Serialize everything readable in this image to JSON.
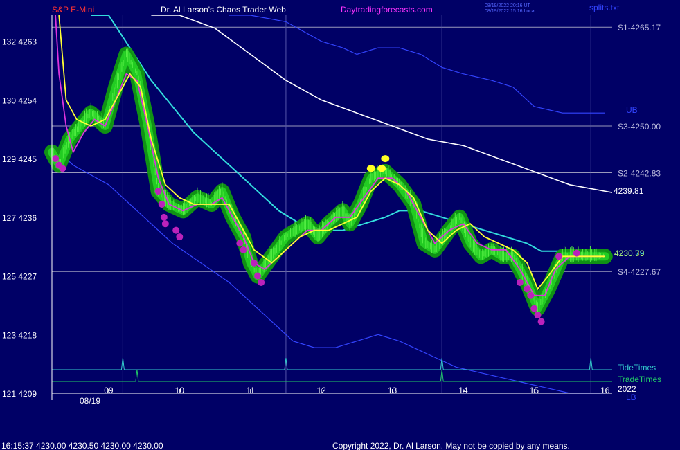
{
  "header": {
    "symbol": "S&P E-Mini",
    "site_title": "Dr. Al Larson's Chaos Trader Web",
    "site_url": "Daytradingforecasts.com",
    "utc_time": "08/19/2022 20:16 UT",
    "local_time": "08/19/2022 15:16 Local",
    "file": "splits.txt"
  },
  "footer": {
    "quote": "16:15:37  4230.00 4230.50 4230.00 4230.00",
    "copyright": "Copyright 2022, Dr. Al Larson. May not be copied by any means."
  },
  "colors": {
    "background": "#000066",
    "price": "#22cc22",
    "glow": "#119911",
    "yellow_avg": "#ffff33",
    "magenta_avg": "#dd33dd",
    "cyan_avg": "#33dddd",
    "white_avg": "#ffffff",
    "band": "#3344ff",
    "title_red": "#ff3333",
    "title_magenta": "#ff33ff",
    "tide": "#33cccc",
    "trade": "#22cc66"
  },
  "chart_data": {
    "type": "line",
    "y_axis": {
      "ticks": [
        {
          "price": 4263,
          "alt": "132",
          "label": "132  4263"
        },
        {
          "price": 4254,
          "alt": "130",
          "label": "130  4254"
        },
        {
          "price": 4245,
          "alt": "129",
          "label": "129  4245"
        },
        {
          "price": 4236,
          "alt": "127",
          "label": "127  4236"
        },
        {
          "price": 4227,
          "alt": "125",
          "label": "125  4227"
        },
        {
          "price": 4218,
          "alt": "123",
          "label": "123  4218"
        },
        {
          "price": 4209,
          "alt": "121",
          "label": "121  4209"
        }
      ],
      "range": [
        4209,
        4267
      ]
    },
    "x_axis": {
      "hour_ticks": [
        {
          "hour": 9,
          "label": "09"
        },
        {
          "hour": 10,
          "label": "10"
        },
        {
          "hour": 11,
          "label": "11"
        },
        {
          "hour": 12,
          "label": "12"
        },
        {
          "hour": 13,
          "label": "13"
        },
        {
          "hour": 14,
          "label": "14"
        },
        {
          "hour": 15,
          "label": "15"
        },
        {
          "hour": 16,
          "label": "16"
        }
      ],
      "date_label": "08/19",
      "year_label": "2022",
      "range": [
        8.2,
        16.1
      ]
    },
    "levels": [
      {
        "label": "S1-4265.17",
        "price": 4265.17
      },
      {
        "label": "S3-4250.00",
        "price": 4250.0
      },
      {
        "label": "S2-4242.83",
        "price": 4242.83
      },
      {
        "label": "S4-4227.67",
        "price": 4227.67
      }
    ],
    "right_labels": {
      "white_end": "4239.81",
      "white_end_price": 4239.81,
      "cyan_end": "4230.79",
      "yellow_end": "4230.33",
      "band_upper": "UB",
      "band_lower": "LB"
    },
    "vertical_lines_hours": [
      9.2,
      11.5,
      13.7,
      15.8
    ],
    "tide_times": {
      "label": "TideTimes",
      "spike_hours": [
        9.2,
        11.5,
        13.7,
        15.8
      ]
    },
    "trade_times": {
      "label": "TradeTimes",
      "spike_hours": [
        9.4,
        13.7
      ]
    },
    "series": [
      {
        "key": "price",
        "points": [
          [
            8.2,
            4246
          ],
          [
            8.3,
            4244
          ],
          [
            8.45,
            4248
          ],
          [
            8.6,
            4250
          ],
          [
            8.75,
            4252
          ],
          [
            8.95,
            4250
          ],
          [
            9.1,
            4256
          ],
          [
            9.25,
            4261
          ],
          [
            9.4,
            4258
          ],
          [
            9.55,
            4250
          ],
          [
            9.7,
            4240
          ],
          [
            9.85,
            4238
          ],
          [
            10.05,
            4237
          ],
          [
            10.25,
            4239
          ],
          [
            10.45,
            4238
          ],
          [
            10.6,
            4240
          ],
          [
            10.75,
            4236
          ],
          [
            10.9,
            4233
          ],
          [
            11.0,
            4229
          ],
          [
            11.1,
            4227
          ],
          [
            11.3,
            4230
          ],
          [
            11.5,
            4233
          ],
          [
            11.65,
            4234
          ],
          [
            11.8,
            4235
          ],
          [
            11.95,
            4233
          ],
          [
            12.1,
            4235
          ],
          [
            12.3,
            4237
          ],
          [
            12.4,
            4235
          ],
          [
            12.55,
            4238
          ],
          [
            12.7,
            4242
          ],
          [
            12.9,
            4243
          ],
          [
            13.1,
            4241
          ],
          [
            13.3,
            4238
          ],
          [
            13.45,
            4232
          ],
          [
            13.6,
            4231
          ],
          [
            13.8,
            4234
          ],
          [
            13.95,
            4236
          ],
          [
            14.1,
            4232
          ],
          [
            14.25,
            4230
          ],
          [
            14.4,
            4231
          ],
          [
            14.55,
            4230
          ],
          [
            14.7,
            4230
          ],
          [
            14.9,
            4226
          ],
          [
            15.05,
            4222
          ],
          [
            15.2,
            4225
          ],
          [
            15.4,
            4230
          ],
          [
            15.6,
            4230
          ],
          [
            15.75,
            4230
          ],
          [
            16.0,
            4230
          ]
        ]
      },
      {
        "key": "yellow",
        "points": [
          [
            8.3,
            4270
          ],
          [
            8.4,
            4254
          ],
          [
            8.55,
            4251
          ],
          [
            8.75,
            4250
          ],
          [
            8.95,
            4251
          ],
          [
            9.15,
            4255
          ],
          [
            9.3,
            4258
          ],
          [
            9.45,
            4256
          ],
          [
            9.6,
            4248
          ],
          [
            9.8,
            4241
          ],
          [
            10.0,
            4239
          ],
          [
            10.2,
            4238
          ],
          [
            10.45,
            4238
          ],
          [
            10.7,
            4238
          ],
          [
            10.85,
            4235
          ],
          [
            11.05,
            4231
          ],
          [
            11.3,
            4229
          ],
          [
            11.5,
            4231
          ],
          [
            11.7,
            4233
          ],
          [
            11.9,
            4234
          ],
          [
            12.1,
            4234
          ],
          [
            12.3,
            4235
          ],
          [
            12.5,
            4236
          ],
          [
            12.7,
            4240
          ],
          [
            12.9,
            4242
          ],
          [
            13.1,
            4241
          ],
          [
            13.3,
            4239
          ],
          [
            13.5,
            4234
          ],
          [
            13.7,
            4232
          ],
          [
            13.9,
            4234
          ],
          [
            14.1,
            4235
          ],
          [
            14.3,
            4233
          ],
          [
            14.5,
            4232
          ],
          [
            14.7,
            4231
          ],
          [
            14.9,
            4229
          ],
          [
            15.05,
            4225
          ],
          [
            15.2,
            4227
          ],
          [
            15.4,
            4230
          ],
          [
            15.6,
            4230
          ],
          [
            15.8,
            4230
          ],
          [
            16.0,
            4230
          ]
        ]
      },
      {
        "key": "magenta",
        "points": [
          [
            8.25,
            4274
          ],
          [
            8.3,
            4258
          ],
          [
            8.4,
            4250
          ],
          [
            8.5,
            4246
          ],
          [
            8.65,
            4249
          ],
          [
            8.8,
            4251
          ],
          [
            8.95,
            4250
          ],
          [
            9.1,
            4254
          ],
          [
            9.25,
            4258
          ],
          [
            9.4,
            4257
          ],
          [
            9.55,
            4250
          ],
          [
            9.7,
            4242
          ],
          [
            9.85,
            4238
          ],
          [
            10.05,
            4237
          ],
          [
            10.25,
            4238
          ],
          [
            10.45,
            4238
          ],
          [
            10.6,
            4239
          ],
          [
            10.75,
            4236
          ],
          [
            10.9,
            4233
          ],
          [
            11.05,
            4229
          ],
          [
            11.2,
            4228
          ],
          [
            11.4,
            4230
          ],
          [
            11.6,
            4232
          ],
          [
            11.8,
            4234
          ],
          [
            12.0,
            4234
          ],
          [
            12.2,
            4236
          ],
          [
            12.4,
            4236
          ],
          [
            12.6,
            4239
          ],
          [
            12.8,
            4242
          ],
          [
            13.0,
            4242
          ],
          [
            13.2,
            4240
          ],
          [
            13.4,
            4236
          ],
          [
            13.6,
            4232
          ],
          [
            13.8,
            4234
          ],
          [
            14.0,
            4235
          ],
          [
            14.2,
            4232
          ],
          [
            14.4,
            4231
          ],
          [
            14.6,
            4231
          ],
          [
            14.8,
            4228
          ],
          [
            15.0,
            4224
          ],
          [
            15.15,
            4224
          ],
          [
            15.3,
            4228
          ],
          [
            15.5,
            4230
          ],
          [
            15.75,
            4230
          ],
          [
            16.0,
            4230
          ]
        ]
      },
      {
        "key": "cyan",
        "points": [
          [
            8.75,
            4272
          ],
          [
            9.0,
            4267
          ],
          [
            9.3,
            4262
          ],
          [
            9.6,
            4257
          ],
          [
            9.9,
            4253
          ],
          [
            10.2,
            4249
          ],
          [
            10.5,
            4246
          ],
          [
            10.8,
            4243
          ],
          [
            11.1,
            4240
          ],
          [
            11.4,
            4237
          ],
          [
            11.7,
            4235
          ],
          [
            12.0,
            4234
          ],
          [
            12.3,
            4234
          ],
          [
            12.6,
            4235
          ],
          [
            12.9,
            4236
          ],
          [
            13.1,
            4237
          ],
          [
            13.4,
            4237
          ],
          [
            13.7,
            4236
          ],
          [
            14.0,
            4235
          ],
          [
            14.3,
            4234
          ],
          [
            14.6,
            4233
          ],
          [
            14.9,
            4232
          ],
          [
            15.1,
            4230.8
          ],
          [
            15.4,
            4230.8
          ],
          [
            15.7,
            4230.8
          ],
          [
            16.0,
            4230.8
          ]
        ]
      },
      {
        "key": "white",
        "points": [
          [
            9.6,
            4272
          ],
          [
            10.0,
            4269
          ],
          [
            10.5,
            4265
          ],
          [
            11.0,
            4261
          ],
          [
            11.5,
            4257
          ],
          [
            12.0,
            4254
          ],
          [
            12.5,
            4252
          ],
          [
            13.0,
            4250
          ],
          [
            13.5,
            4248
          ],
          [
            14.0,
            4247
          ],
          [
            14.5,
            4245
          ],
          [
            15.0,
            4243
          ],
          [
            15.5,
            4241
          ],
          [
            16.1,
            4239.8
          ]
        ]
      },
      {
        "key": "band_upper",
        "points": [
          [
            10.7,
            4273
          ],
          [
            11.0,
            4270
          ],
          [
            11.5,
            4266
          ],
          [
            12.0,
            4263
          ],
          [
            12.3,
            4262
          ],
          [
            12.5,
            4261
          ],
          [
            12.8,
            4262
          ],
          [
            13.1,
            4262
          ],
          [
            13.4,
            4261
          ],
          [
            13.7,
            4259
          ],
          [
            14.0,
            4258
          ],
          [
            14.4,
            4257
          ],
          [
            14.7,
            4256
          ],
          [
            15.0,
            4253
          ],
          [
            15.4,
            4252
          ],
          [
            15.8,
            4252
          ],
          [
            16.0,
            4252
          ]
        ]
      },
      {
        "key": "band_lower",
        "points": [
          [
            8.2,
            4247
          ],
          [
            8.5,
            4244
          ],
          [
            9.0,
            4241
          ],
          [
            9.5,
            4236
          ],
          [
            9.9,
            4232
          ],
          [
            10.3,
            4229
          ],
          [
            10.7,
            4226
          ],
          [
            11.0,
            4223
          ],
          [
            11.3,
            4220
          ],
          [
            11.6,
            4217
          ],
          [
            11.9,
            4216
          ],
          [
            12.2,
            4216
          ],
          [
            12.5,
            4217
          ],
          [
            12.8,
            4218
          ],
          [
            13.1,
            4217
          ],
          [
            13.5,
            4215
          ],
          [
            13.9,
            4213
          ],
          [
            14.3,
            4212
          ],
          [
            14.7,
            4211
          ],
          [
            15.1,
            4210
          ],
          [
            15.5,
            4209
          ],
          [
            16.0,
            4208
          ]
        ]
      }
    ],
    "dots": {
      "magenta": [
        [
          8.25,
          4245
        ],
        [
          8.3,
          4244
        ],
        [
          8.35,
          4243.5
        ],
        [
          9.7,
          4240
        ],
        [
          9.75,
          4238
        ],
        [
          9.78,
          4236
        ],
        [
          9.8,
          4235
        ],
        [
          9.95,
          4234
        ],
        [
          10.0,
          4233
        ],
        [
          10.85,
          4232
        ],
        [
          10.9,
          4231
        ],
        [
          11.05,
          4229
        ],
        [
          11.1,
          4227
        ],
        [
          11.15,
          4226
        ],
        [
          14.8,
          4226
        ],
        [
          14.9,
          4225
        ],
        [
          14.95,
          4224
        ],
        [
          15.0,
          4222
        ],
        [
          15.05,
          4221
        ],
        [
          15.1,
          4220
        ],
        [
          15.35,
          4230
        ],
        [
          15.6,
          4230.5
        ]
      ],
      "yellow": [
        [
          12.7,
          4243.5
        ],
        [
          12.9,
          4245
        ],
        [
          12.85,
          4243.5
        ]
      ]
    }
  }
}
